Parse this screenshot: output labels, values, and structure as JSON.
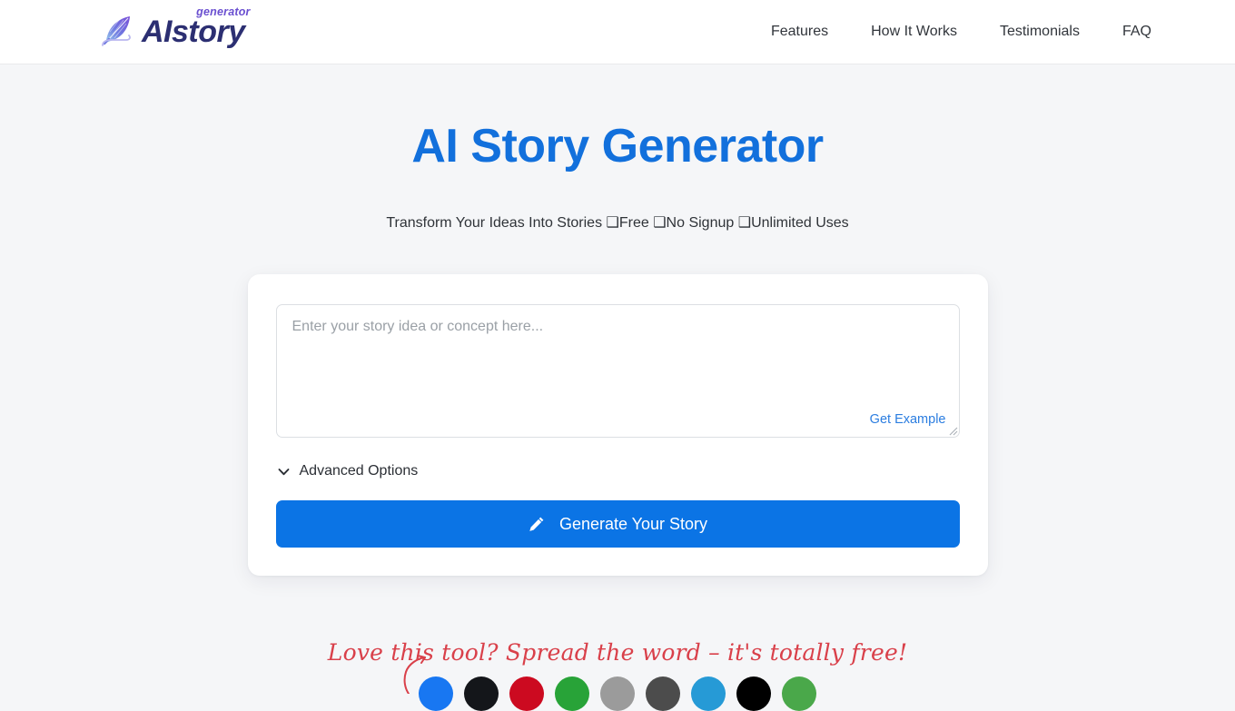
{
  "brand": {
    "name": "AIstory",
    "superscript": "generator",
    "icon": "feather-quill-icon"
  },
  "nav": {
    "items": [
      {
        "label": "Features"
      },
      {
        "label": "How It Works"
      },
      {
        "label": "Testimonials"
      },
      {
        "label": "FAQ"
      }
    ]
  },
  "hero": {
    "title": "AI Story Generator",
    "subtitle": "Transform Your Ideas Into Stories ❑Free ❑No Signup ❑Unlimited Uses",
    "title_color": "#1270dc"
  },
  "generator": {
    "input_value": "",
    "input_placeholder": "Enter your story idea or concept here...",
    "get_example_label": "Get Example",
    "advanced_options_label": "Advanced Options",
    "generate_label": "Generate Your Story",
    "generate_color": "#0b74e5",
    "link_color": "#2b7de0"
  },
  "share": {
    "tagline": "Love this tool? Spread the word – it's totally free!",
    "tagline_color": "#d9404a",
    "buttons": [
      {
        "name": "facebook",
        "color": "#1877f2"
      },
      {
        "name": "x-twitter",
        "color": "#14161a"
      },
      {
        "name": "pinterest",
        "color": "#cc0a20"
      },
      {
        "name": "whatsapp",
        "color": "#28a338"
      },
      {
        "name": "sms",
        "color": "#9b9b9b"
      },
      {
        "name": "email",
        "color": "#4c4c4c"
      },
      {
        "name": "telegram",
        "color": "#269ad6"
      },
      {
        "name": "tiktok",
        "color": "#000000"
      },
      {
        "name": "line",
        "color": "#4aa84a"
      }
    ]
  }
}
